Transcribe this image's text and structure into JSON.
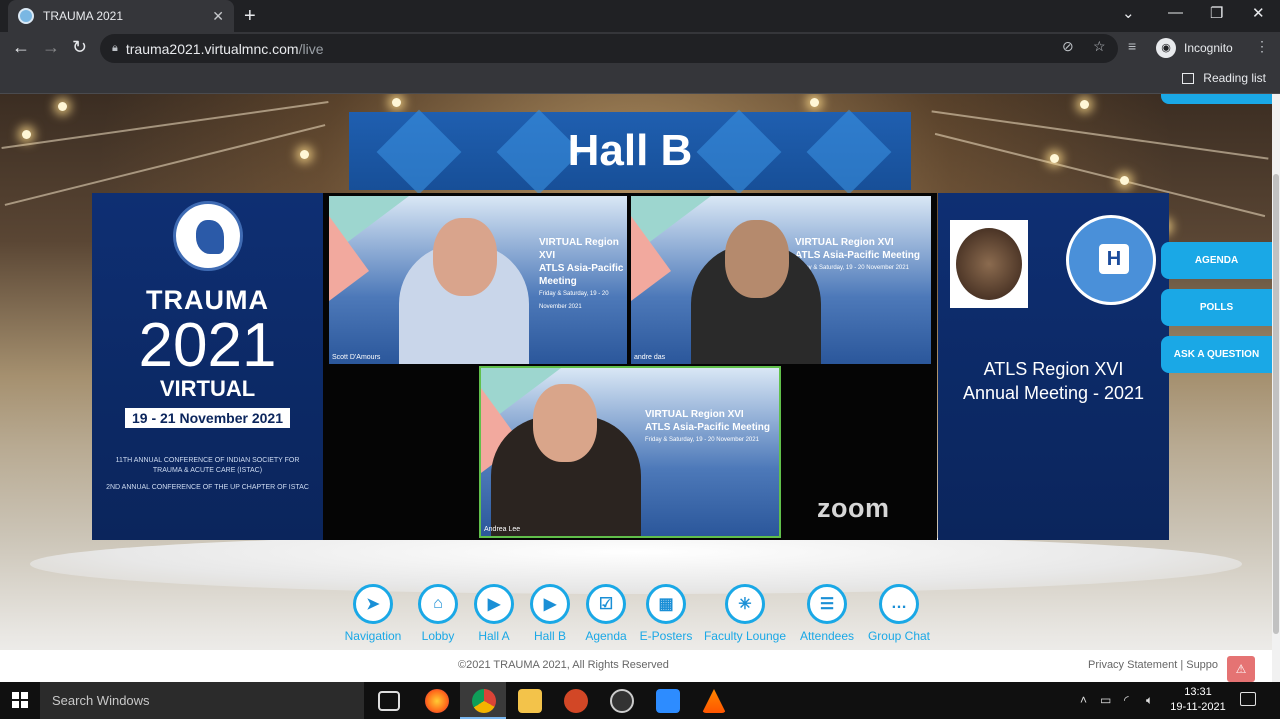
{
  "browser": {
    "tab_title": "TRAUMA 2021",
    "tab_close": "✕",
    "new_tab": "+",
    "url_host": "trauma2021.virtualmnc.com",
    "url_path": "/live",
    "incognito_label": "Incognito",
    "reading_list_label": "Reading list"
  },
  "hall": {
    "banner_title": "Hall B"
  },
  "left_panel": {
    "trauma": "TRAUMA",
    "year": "2021",
    "virtual": "VIRTUAL",
    "dates": "19 - 21 November 2021",
    "conference_line1": "11TH ANNUAL CONFERENCE OF INDIAN SOCIETY FOR TRAUMA & ACUTE CARE (ISTAC)",
    "conference_line2": "2ND ANNUAL CONFERENCE OF THE UP CHAPTER OF ISTAC"
  },
  "zoom": {
    "slide_line1": "VIRTUAL Region XVI",
    "slide_line2": "ATLS Asia-Pacific Meeting",
    "slide_line3": "Friday & Saturday, 19 - 20 November 2021",
    "participants": [
      {
        "name": "Scott D'Amours"
      },
      {
        "name": "andre das"
      },
      {
        "name": "Andrea Lee"
      }
    ],
    "logo": "zoom"
  },
  "right_panel": {
    "title_line1": "ATLS Region XVI",
    "title_line2": "Annual Meeting - 2021"
  },
  "side_buttons": {
    "agenda": "AGENDA",
    "polls": "POLLS",
    "ask_question": "ASK A QUESTION"
  },
  "bottom_nav": [
    {
      "label": "Navigation",
      "icon": "navigation-arrow-icon"
    },
    {
      "label": "Lobby",
      "icon": "reception-desk-icon"
    },
    {
      "label": "Hall A",
      "icon": "video-play-icon"
    },
    {
      "label": "Hall B",
      "icon": "video-play-icon"
    },
    {
      "label": "Agenda",
      "icon": "clipboard-checklist-icon"
    },
    {
      "label": "E-Posters",
      "icon": "poster-board-icon"
    },
    {
      "label": "Faculty Lounge",
      "icon": "network-nodes-icon"
    },
    {
      "label": "Attendees",
      "icon": "id-badge-icon"
    },
    {
      "label": "Group Chat",
      "icon": "chat-bubble-icon"
    }
  ],
  "footer": {
    "copyright": "©2021 TRAUMA 2021, All Rights Reserved",
    "links": "Privacy Statement | Suppo"
  },
  "taskbar": {
    "search_placeholder": "Search Windows",
    "time": "13:31",
    "date": "19-11-2021"
  },
  "colors": {
    "accent_blue": "#1aa8e6",
    "panel_navy": "#0b255c",
    "active_speaker": "#61c04b"
  }
}
